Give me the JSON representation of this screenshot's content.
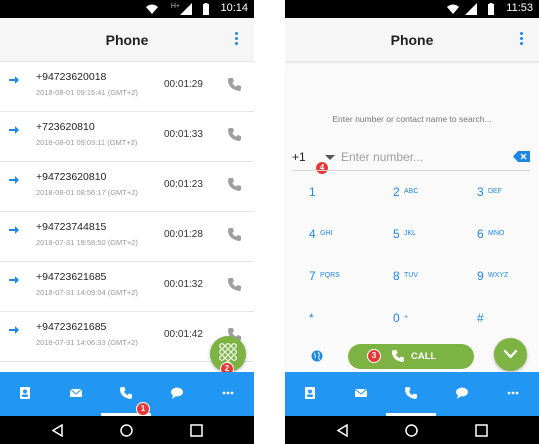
{
  "left": {
    "status_time": "10:14",
    "title": "Phone",
    "calls": [
      {
        "number": "+94723620018",
        "timestamp": "2018-08-01 09:15:41 (GMT+2)",
        "duration": "00:01:29"
      },
      {
        "number": "+723620810",
        "timestamp": "2018-08-01 09:03:11 (GMT+2)",
        "duration": "00:01:33"
      },
      {
        "number": "+94723620810",
        "timestamp": "2018-08-01 08:56:17 (GMT+2)",
        "duration": "00:01:23"
      },
      {
        "number": "+94723744815",
        "timestamp": "2018-07-31 19:58:50 (GMT+2)",
        "duration": "00:01:28"
      },
      {
        "number": "+94723621685",
        "timestamp": "2018-07-31 14:09:04 (GMT+2)",
        "duration": "00:01:32"
      },
      {
        "number": "+94723621685",
        "timestamp": "2018-07-31 14:06:33 (GMT+2)",
        "duration": "00:01:42"
      }
    ],
    "badges": {
      "b1": "1",
      "b2": "2"
    }
  },
  "right": {
    "status_time": "11:53",
    "title": "Phone",
    "search_hint": "Enter number or contact name to search...",
    "country_code": "+1",
    "number_placeholder": "Enter number...",
    "keys": [
      {
        "digit": "1",
        "letters": ""
      },
      {
        "digit": "2",
        "letters": "ABC"
      },
      {
        "digit": "3",
        "letters": "DEF"
      },
      {
        "digit": "4",
        "letters": "GHI"
      },
      {
        "digit": "5",
        "letters": "JKL"
      },
      {
        "digit": "6",
        "letters": "MNO"
      },
      {
        "digit": "7",
        "letters": "PQRS"
      },
      {
        "digit": "8",
        "letters": "TUV"
      },
      {
        "digit": "9",
        "letters": "WXYZ"
      },
      {
        "digit": "*",
        "letters": ""
      },
      {
        "digit": "0",
        "letters": "+"
      },
      {
        "digit": "#",
        "letters": ""
      }
    ],
    "call_label": "CALL",
    "badges": {
      "b3": "3",
      "b4": "4"
    }
  },
  "bottom_tabs": [
    "contacts-icon",
    "messages-icon",
    "phone-icon",
    "chat-icon",
    "more-icon"
  ],
  "colors": {
    "accent": "#2196f3",
    "call_green": "#7cb342",
    "badge_red": "#e53935",
    "blue_text": "#1e88e5"
  }
}
